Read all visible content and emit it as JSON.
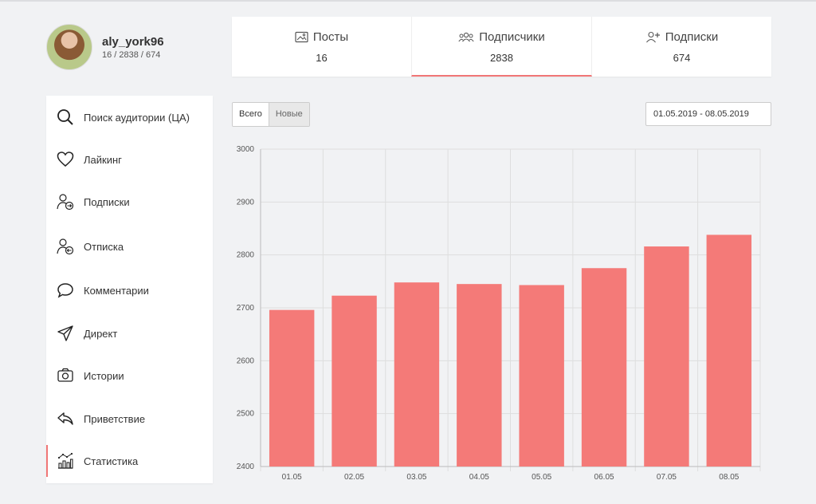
{
  "profile": {
    "username": "aly_york96",
    "counts": "16 / 2838 / 674"
  },
  "stats": [
    {
      "label": "Посты",
      "value": "16",
      "icon": "image-icon"
    },
    {
      "label": "Подписчики",
      "value": "2838",
      "icon": "users-icon"
    },
    {
      "label": "Подписки",
      "value": "674",
      "icon": "user-plus-icon"
    }
  ],
  "menu": [
    {
      "label": "Поиск аудитории (ЦА)",
      "icon": "search-icon"
    },
    {
      "label": "Лайкинг",
      "icon": "heart-icon"
    },
    {
      "label": "Подписки",
      "icon": "user-follow-icon"
    },
    {
      "label": "Отписка",
      "icon": "user-unfollow-icon"
    },
    {
      "label": "Комментарии",
      "icon": "comment-icon"
    },
    {
      "label": "Директ",
      "icon": "send-icon"
    },
    {
      "label": "Истории",
      "icon": "camera-icon"
    },
    {
      "label": "Приветствие",
      "icon": "reply-icon"
    },
    {
      "label": "Статистика",
      "icon": "stats-icon"
    }
  ],
  "filters": {
    "all_label": "Всего",
    "new_label": "Новые",
    "date_range": "01.05.2019 - 08.05.2019"
  },
  "colors": {
    "accent": "#f07676",
    "bar": "#f47a78"
  },
  "chart_data": {
    "type": "bar",
    "categories": [
      "01.05",
      "02.05",
      "03.05",
      "04.05",
      "05.05",
      "06.05",
      "07.05",
      "08.05"
    ],
    "values": [
      2696,
      2723,
      2748,
      2745,
      2743,
      2775,
      2816,
      2838
    ],
    "yticks": [
      2400,
      2500,
      2600,
      2700,
      2800,
      2900,
      3000
    ],
    "ylim": [
      2400,
      3000
    ],
    "grid": true
  }
}
